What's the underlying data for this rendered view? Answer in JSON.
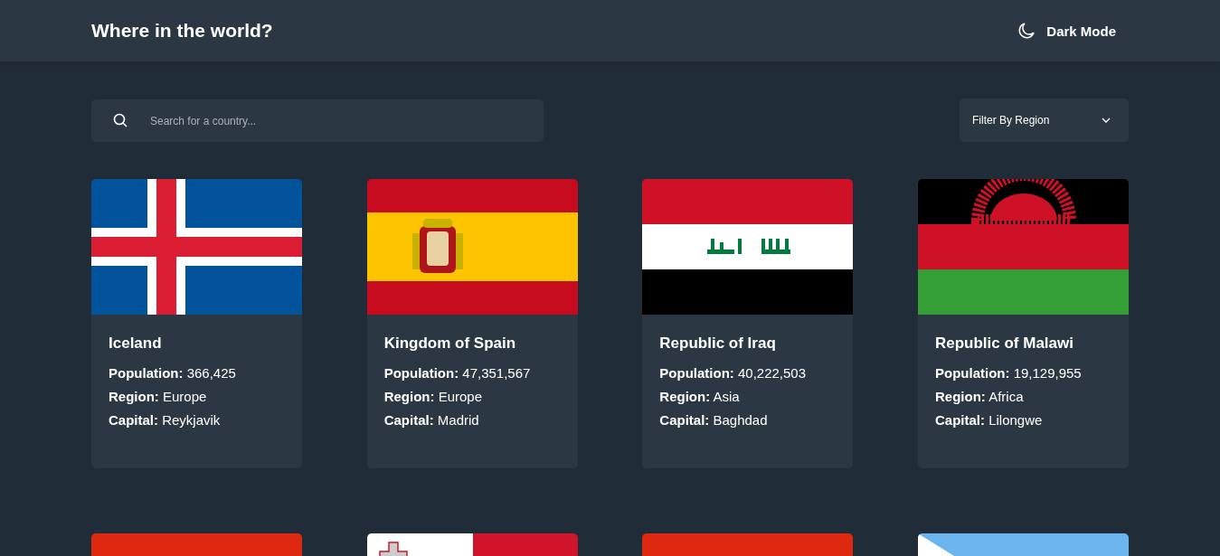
{
  "header": {
    "title": "Where in the world?",
    "theme_toggle": "Dark Mode"
  },
  "search": {
    "placeholder": "Search for a country..."
  },
  "filter": {
    "label": "Filter By Region"
  },
  "countries": [
    {
      "kind": "iceland",
      "name": "Iceland",
      "details": [
        {
          "label": "Population:",
          "value": "366,425"
        },
        {
          "label": "Region:",
          "value": "Europe"
        },
        {
          "label": "Capital:",
          "value": "Reykjavik"
        }
      ]
    },
    {
      "kind": "spain",
      "name": "Kingdom of Spain",
      "details": [
        {
          "label": "Population:",
          "value": "47,351,567"
        },
        {
          "label": "Region:",
          "value": "Europe"
        },
        {
          "label": "Capital:",
          "value": "Madrid"
        }
      ]
    },
    {
      "kind": "iraq",
      "name": "Republic of Iraq",
      "details": [
        {
          "label": "Population:",
          "value": "40,222,503"
        },
        {
          "label": "Region:",
          "value": "Asia"
        },
        {
          "label": "Capital:",
          "value": "Baghdad"
        }
      ]
    },
    {
      "kind": "malawi",
      "name": "Republic of Malawi",
      "details": [
        {
          "label": "Population:",
          "value": "19,129,955"
        },
        {
          "label": "Region:",
          "value": "Africa"
        },
        {
          "label": "Capital:",
          "value": "Lilongwe"
        }
      ]
    },
    {
      "kind": "red"
    },
    {
      "kind": "malta"
    },
    {
      "kind": "red"
    },
    {
      "kind": "blue-diagonal"
    }
  ]
}
